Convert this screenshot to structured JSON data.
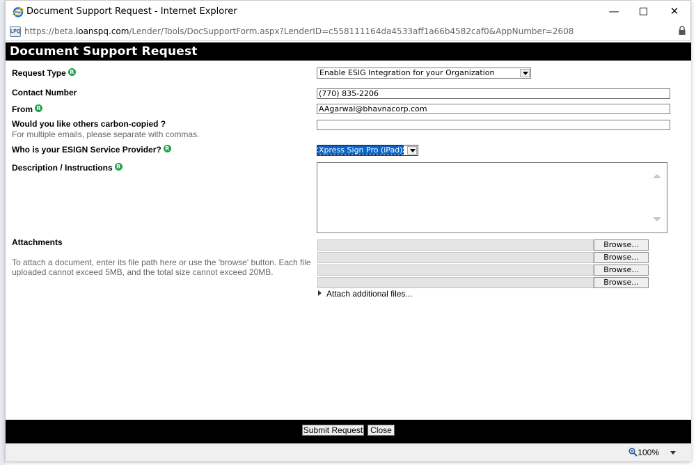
{
  "window": {
    "title": "Document Support Request - Internet Explorer",
    "minimize_glyph": "—",
    "maximize_glyph": "☐",
    "close_glyph": "✕"
  },
  "address": {
    "prefix": "https://beta.",
    "domain": "loanspq.com",
    "path": "/Lender/Tools/DocSupportForm.aspx?LenderID=c558111164da4533aff1a66b4582caf0&AppNumber=2608",
    "site_icon_text": "LPQ"
  },
  "form": {
    "title": "Document Support Request",
    "required_marker": "R",
    "request_type": {
      "label": "Request Type",
      "value": "Enable ESIG Integration for your Organization"
    },
    "contact_number": {
      "label": "Contact Number",
      "value": "(770) 835-2206"
    },
    "from": {
      "label": "From",
      "value": "AAgarwal@bhavnacorp.com"
    },
    "cc": {
      "label": "Would you like others carbon-copied ?",
      "hint": "For multiple emails, please separate with commas.",
      "value": ""
    },
    "esign_provider": {
      "label": "Who is your ESIGN Service Provider?",
      "value": "Xpress Sign Pro (iPad)"
    },
    "description": {
      "label": "Description / Instructions",
      "value": ""
    },
    "attachments": {
      "label": "Attachments",
      "hint": "To attach a document, enter its file path here or use the 'browse' button. Each file uploaded cannot exceed 5MB, and the total size cannot exceed 20MB.",
      "browse_label": "Browse...",
      "add_more_label": "Attach additional files..."
    }
  },
  "footer": {
    "submit_label": "Submit Request",
    "close_label": "Close"
  },
  "status": {
    "zoom": "100%"
  },
  "colors": {
    "header_bg": "#000000",
    "required_badge": "#1aa34a",
    "selected_option_bg": "#0a64c8"
  }
}
